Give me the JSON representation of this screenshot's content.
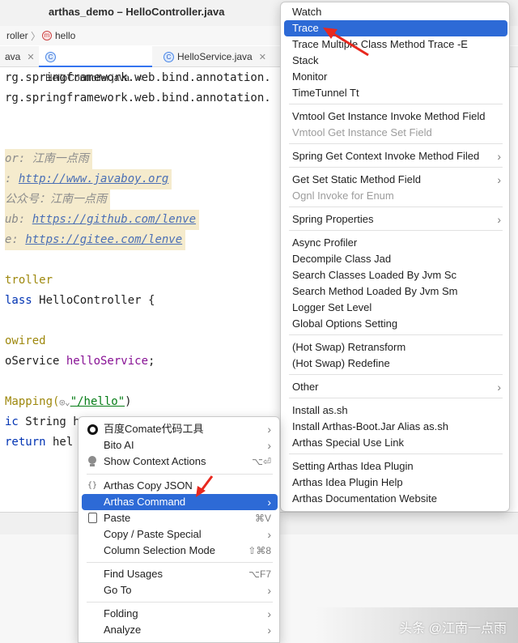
{
  "window": {
    "title": "arthas_demo – HelloController.java"
  },
  "breadcrumb": {
    "class_name": "roller",
    "method_icon": "m",
    "method_name": "hello"
  },
  "tabs": [
    {
      "label": "ava",
      "icon": ""
    },
    {
      "label": "HelloController.java",
      "icon": "C"
    },
    {
      "label": "HelloService.java",
      "icon": "C"
    }
  ],
  "tab_close": "✕",
  "code": {
    "import1": "rg.springframework.web.bind.annotation.",
    "import2": "rg.springframework.web.bind.annotation.",
    "author": "or: 江南一点雨",
    "site_prefix": ": ",
    "site_url": "http://www.javaboy.org",
    "wechat": "公众号：江南一点雨",
    "github_prefix": "ub: ",
    "github_url": "https://github.com/lenve",
    "gitee_prefix": "e: ",
    "gitee_url": "https://gitee.com/lenve",
    "anno_controller": "troller",
    "class_kw": "lass",
    "class_decl": " HelloController {",
    "anno_autowired": "owired",
    "field_type": "oService ",
    "field_name": "helloService",
    "field_end": ";",
    "mapping_prefix": "Mapping(",
    "mapping_icon": "◎⌄",
    "mapping_path": "\"/hello\"",
    "mapping_end": ")",
    "method_kw": "ic",
    "method_rest": " String h",
    "return_kw": "return",
    "return_rest": " hel"
  },
  "context_menu": {
    "items": [
      {
        "label": "百度Comate代码工具",
        "arrow": "›"
      },
      {
        "label": "Bito AI",
        "arrow": "›"
      },
      {
        "label": "Show Context Actions",
        "shortcut": "⌥⏎"
      },
      {
        "label": "Arthas Copy JSON",
        "icon": "{}"
      },
      {
        "label": "Arthas Command",
        "arrow": "›"
      },
      {
        "label": "Paste",
        "shortcut": "⌘V"
      },
      {
        "label": "Copy / Paste Special",
        "arrow": "›"
      },
      {
        "label": "Column Selection Mode",
        "shortcut": "⇧⌘8"
      },
      {
        "label": "Find Usages",
        "shortcut": "⌥F7"
      },
      {
        "label": "Go To",
        "arrow": "›"
      },
      {
        "label": "Folding",
        "arrow": "›"
      },
      {
        "label": "Analyze",
        "arrow": "›"
      }
    ]
  },
  "submenu": {
    "items": [
      {
        "label": "Watch"
      },
      {
        "label": "Trace"
      },
      {
        "label": "Trace Multiple Class Method Trace -E"
      },
      {
        "label": "Stack"
      },
      {
        "label": "Monitor"
      },
      {
        "label": "TimeTunnel Tt"
      },
      {
        "label": "Vmtool Get Instance Invoke Method Field"
      },
      {
        "label": "Vmtool Get Instance Set Field"
      },
      {
        "label": "Spring Get Context Invoke Method Filed",
        "arrow": "›"
      },
      {
        "label": "Get Set Static Method Field",
        "arrow": "›"
      },
      {
        "label": "Ognl Invoke for Enum"
      },
      {
        "label": "Spring Properties",
        "arrow": "›"
      },
      {
        "label": "Async Profiler"
      },
      {
        "label": "Decompile Class Jad"
      },
      {
        "label": "Search Classes Loaded By Jvm Sc"
      },
      {
        "label": "Search Method Loaded By Jvm Sm"
      },
      {
        "label": "Logger Set Level"
      },
      {
        "label": "Global Options Setting"
      },
      {
        "label": "(Hot Swap) Retransform"
      },
      {
        "label": "(Hot Swap) Redefine"
      },
      {
        "label": "Other",
        "arrow": "›"
      },
      {
        "label": "Install as.sh"
      },
      {
        "label": "Install Arthas-Boot.Jar Alias as.sh"
      },
      {
        "label": "Arthas Special Use Link"
      },
      {
        "label": "Setting Arthas Idea Plugin"
      },
      {
        "label": "Arthas Idea Plugin Help"
      },
      {
        "label": "Arthas Documentation Website"
      }
    ]
  },
  "watermark": {
    "text": "头条 @江南一点雨"
  },
  "colors": {
    "selection": "#2d6ad6",
    "annotation_arrow": "#e8281e",
    "comment_bg": "#f5ebcd"
  }
}
